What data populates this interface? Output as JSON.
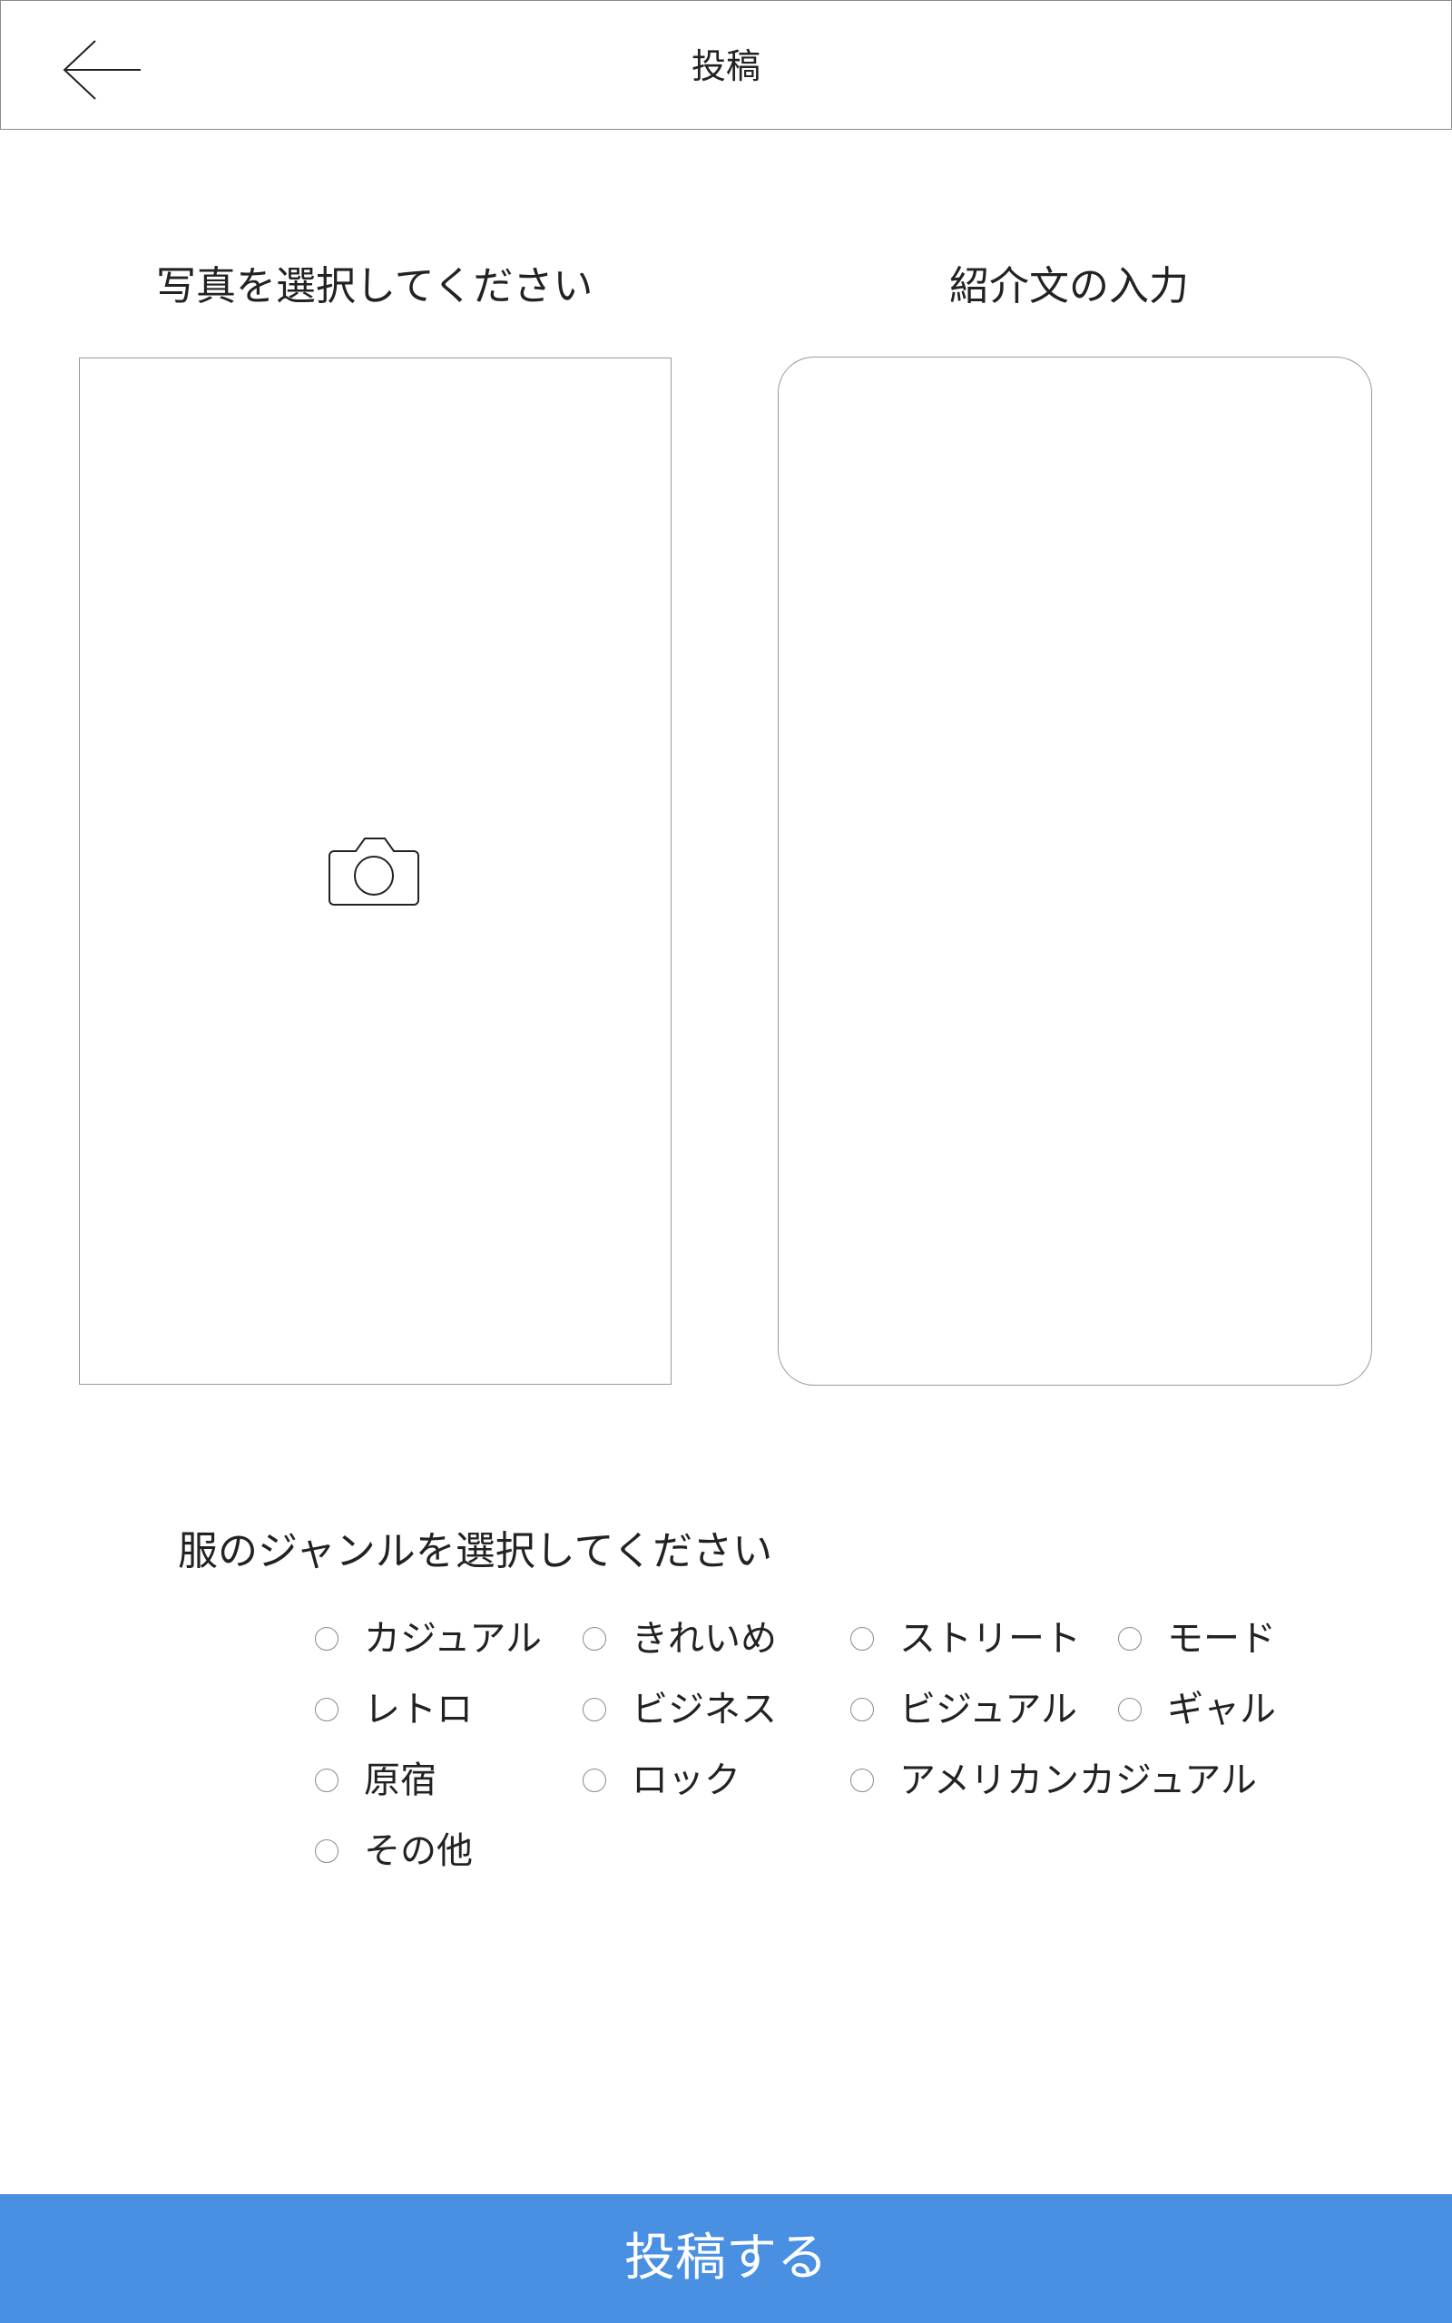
{
  "header": {
    "back_icon": "arrow-left-icon",
    "title": "投稿"
  },
  "photo": {
    "label": "写真を選択してください",
    "icon": "camera-icon"
  },
  "intro": {
    "label": "紹介文の入力",
    "value": ""
  },
  "genre": {
    "label": "服のジャンルを選択してください",
    "options": [
      {
        "label": "カジュアル",
        "selected": false
      },
      {
        "label": "きれいめ",
        "selected": false
      },
      {
        "label": "ストリート",
        "selected": false
      },
      {
        "label": "モード",
        "selected": false
      },
      {
        "label": "レトロ",
        "selected": false
      },
      {
        "label": "ビジネス",
        "selected": false
      },
      {
        "label": "ビジュアル",
        "selected": false
      },
      {
        "label": "ギャル",
        "selected": false
      },
      {
        "label": "原宿",
        "selected": false
      },
      {
        "label": "ロック",
        "selected": false
      },
      {
        "label": "アメリカンカジュアル",
        "selected": false
      },
      {
        "label": "その他",
        "selected": false
      }
    ]
  },
  "submit": {
    "label": "投稿する",
    "color": "#4a90e2"
  }
}
